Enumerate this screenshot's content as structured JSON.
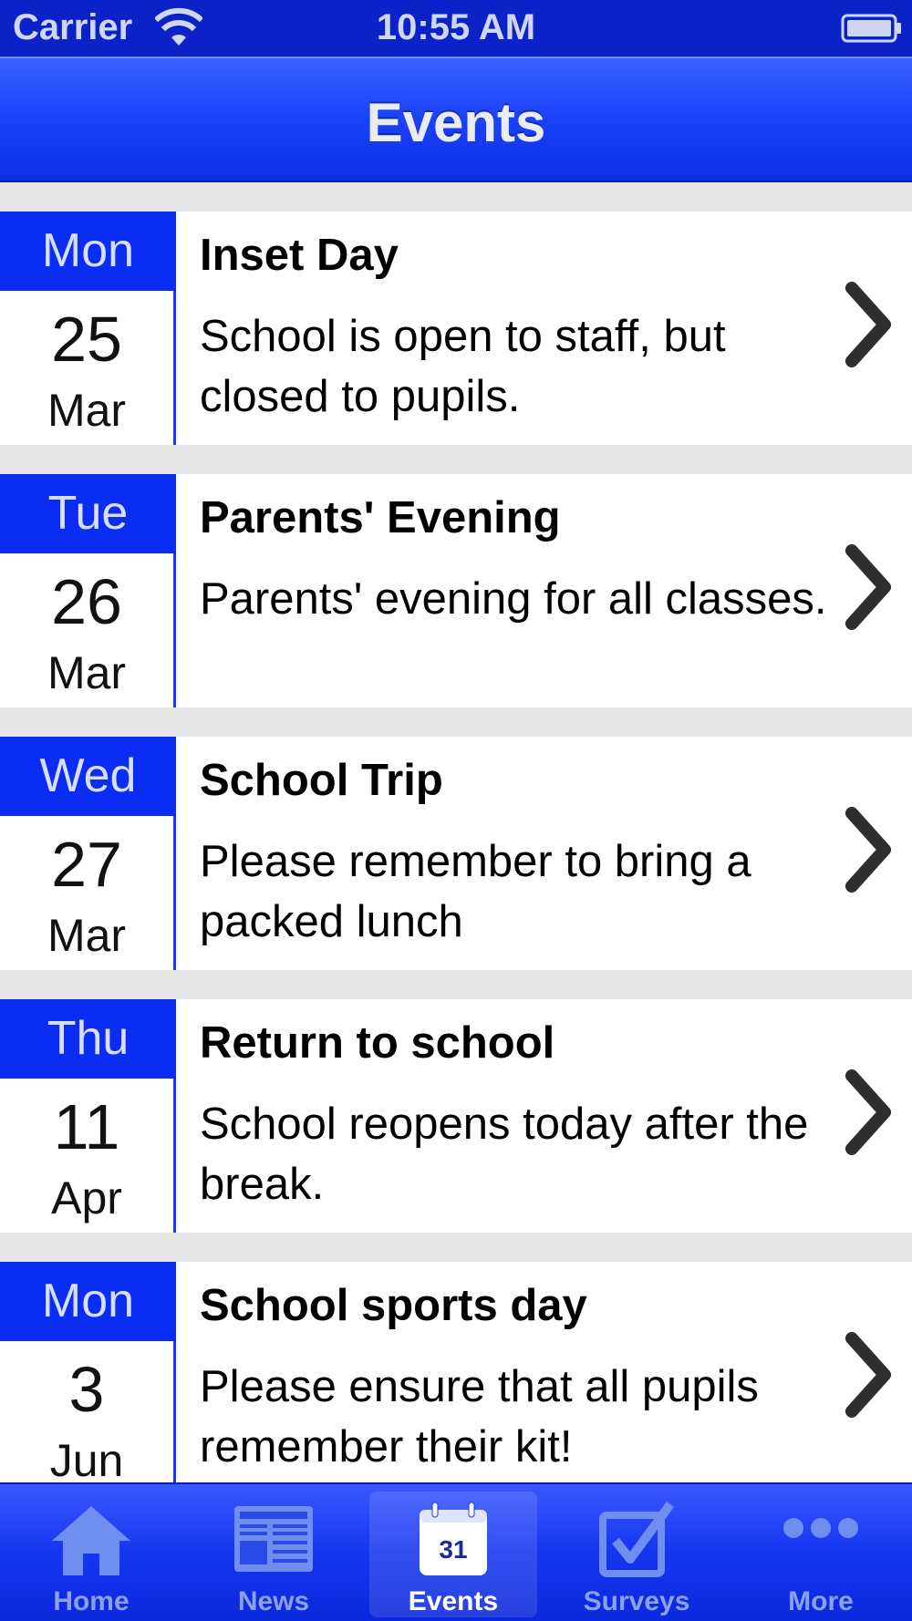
{
  "status_bar": {
    "carrier": "Carrier",
    "time": "10:55 AM",
    "wifi_icon": "wifi-icon",
    "battery_icon": "battery-icon"
  },
  "nav": {
    "title": "Events"
  },
  "events": [
    {
      "day": "Mon",
      "date": "25",
      "month": "Mar",
      "title": "Inset Day",
      "description": "School is open to staff, but closed to pupils."
    },
    {
      "day": "Tue",
      "date": "26",
      "month": "Mar",
      "title": "Parents' Evening",
      "description": "Parents' evening for all classes."
    },
    {
      "day": "Wed",
      "date": "27",
      "month": "Mar",
      "title": "School Trip",
      "description": "Please remember to bring a packed lunch"
    },
    {
      "day": "Thu",
      "date": "11",
      "month": "Apr",
      "title": "Return to school",
      "description": "School reopens today after the break."
    },
    {
      "day": "Mon",
      "date": "3",
      "month": "Jun",
      "title": "School sports day",
      "description": "Please ensure that all pupils remember their kit!"
    }
  ],
  "tabs": [
    {
      "label": "Home",
      "icon": "home-icon",
      "selected": false
    },
    {
      "label": "News",
      "icon": "newspaper-icon",
      "selected": false
    },
    {
      "label": "Events",
      "icon": "calendar-icon",
      "calendar_number": "31",
      "selected": true
    },
    {
      "label": "Surveys",
      "icon": "checkbox-icon",
      "selected": false
    },
    {
      "label": "More",
      "icon": "more-icon",
      "selected": false
    }
  ],
  "colors": {
    "accent": "#0b2cf2",
    "status_bar": "#0a22c8",
    "tab_active_label": "#ffffff",
    "tab_inactive_label": "#8aa0e8"
  }
}
